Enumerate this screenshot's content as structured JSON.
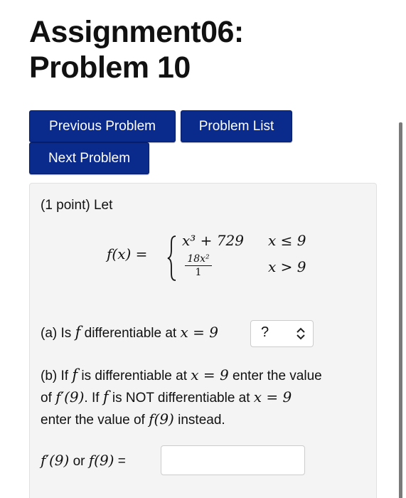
{
  "header": {
    "title_line1": "Assignment06:",
    "title_line2": "Problem 10"
  },
  "nav": {
    "previous_label": "Previous Problem",
    "list_label": "Problem List",
    "next_label": "Next Problem"
  },
  "problem": {
    "points": "(1 point) Let",
    "fx": "f(x) =",
    "case1_expr": "x³ + 729",
    "case1_cond": "x ≤ 9",
    "case2_num": "18x²",
    "case2_den": "1",
    "case2_cond": "x > 9",
    "part_a_prefix": "(a) Is",
    "part_a_f": "f",
    "part_a_mid": "differentiable at",
    "part_a_eq": "x = 9",
    "part_a_select_value": "?",
    "part_b_line1_a": "(b) If",
    "part_b_line1_f": "f",
    "part_b_line1_b": "is differentiable at",
    "part_b_line1_eq": "x = 9",
    "part_b_line1_c": "enter the value",
    "part_b_line2_a": "of",
    "part_b_line2_fp": "f′(9)",
    "part_b_line2_b": ". If",
    "part_b_line2_f": "f",
    "part_b_line2_c": "is NOT differentiable at",
    "part_b_line2_eq": "x = 9",
    "part_b_line3_a": "enter the value of",
    "part_b_line3_f9": "f(9)",
    "part_b_line3_b": "instead.",
    "answer_fp": "f′(9)",
    "answer_or": "or",
    "answer_f9": "f(9)",
    "answer_eq": "=",
    "answer_value": ""
  }
}
